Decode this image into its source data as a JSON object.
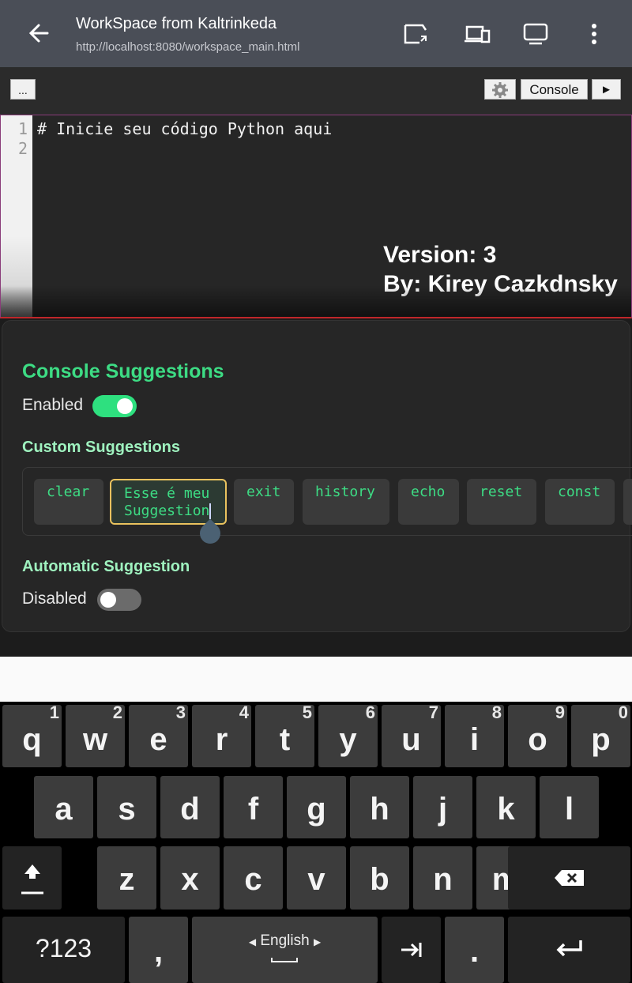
{
  "appbar": {
    "title": "WorkSpace from Kaltrinkeda",
    "url": "http://localhost:8080/workspace_main.html",
    "icons": [
      "back-arrow-icon",
      "cast-icon",
      "devices-icon",
      "monitor-icon",
      "more-vert-icon"
    ]
  },
  "toolbar": {
    "menu_label": "...",
    "settings_icon": "gear-icon",
    "console_label": "Console",
    "run_label": "►"
  },
  "editor": {
    "line_numbers": [
      "1",
      "2"
    ],
    "code": "# Inicie seu código Python aqui",
    "version_text": "Version: 3",
    "author_text": "By: Kirey Cazkdnsky"
  },
  "panel": {
    "title": "Console Suggestions",
    "enabled_label": "Enabled",
    "enabled_on": true,
    "custom_title": "Custom Suggestions",
    "chips": [
      "clear",
      "Esse é meu Suggestion",
      "exit",
      "history",
      "echo",
      "reset",
      "const"
    ],
    "selected_chip_line1": "Esse é meu",
    "selected_chip_line2": "Suggestion",
    "auto_title": "Automatic Suggestion",
    "auto_label": "Disabled",
    "auto_on": false
  },
  "keyboard": {
    "row1": [
      {
        "k": "q",
        "n": "1"
      },
      {
        "k": "w",
        "n": "2"
      },
      {
        "k": "e",
        "n": "3"
      },
      {
        "k": "r",
        "n": "4"
      },
      {
        "k": "t",
        "n": "5"
      },
      {
        "k": "y",
        "n": "6"
      },
      {
        "k": "u",
        "n": "7"
      },
      {
        "k": "i",
        "n": "8"
      },
      {
        "k": "o",
        "n": "9"
      },
      {
        "k": "p",
        "n": "0"
      }
    ],
    "row2": [
      "a",
      "s",
      "d",
      "f",
      "g",
      "h",
      "j",
      "k",
      "l"
    ],
    "row3": [
      "z",
      "x",
      "c",
      "v",
      "b",
      "n",
      "m"
    ],
    "symbols_label": "?123",
    "comma_label": ",",
    "space_label": "English",
    "period_label": ".",
    "colors": {
      "key": "#3c3c3c",
      "special": "#232323",
      "background": "#000000"
    }
  },
  "colors": {
    "accent_green": "#3ddc84",
    "heading_green": "#9ff2bf",
    "chip_border_selected": "#e9c25e"
  }
}
